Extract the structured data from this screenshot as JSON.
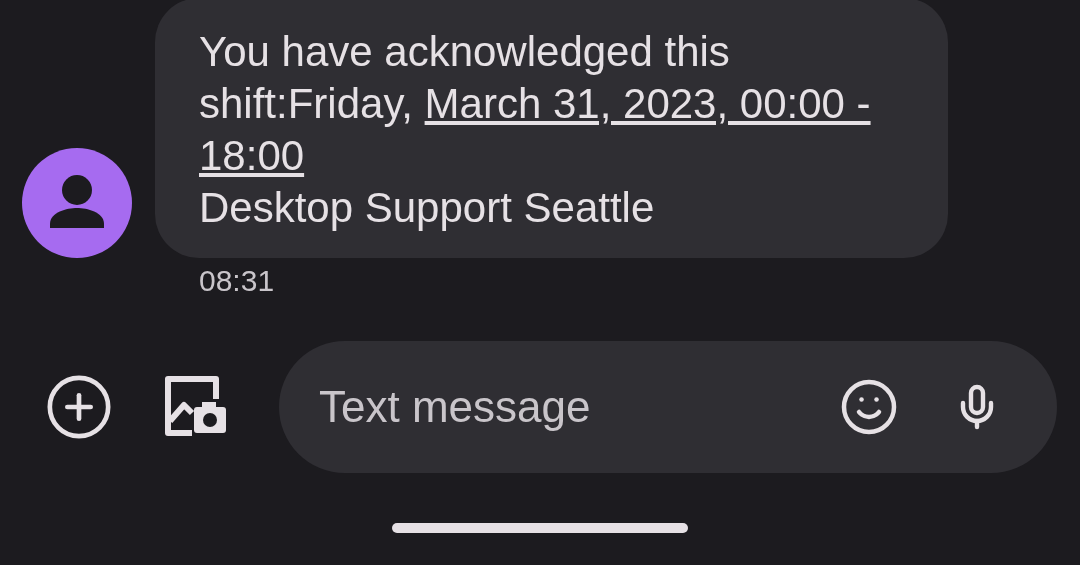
{
  "message": {
    "text": "You have acknowledged this shift:Friday, ",
    "link_lines": [
      "March 31, 2023, 00:00 -",
      "18:00"
    ],
    "after": "Desktop Support Seattle",
    "time": "08:31"
  },
  "composer": {
    "placeholder": "Text message"
  }
}
